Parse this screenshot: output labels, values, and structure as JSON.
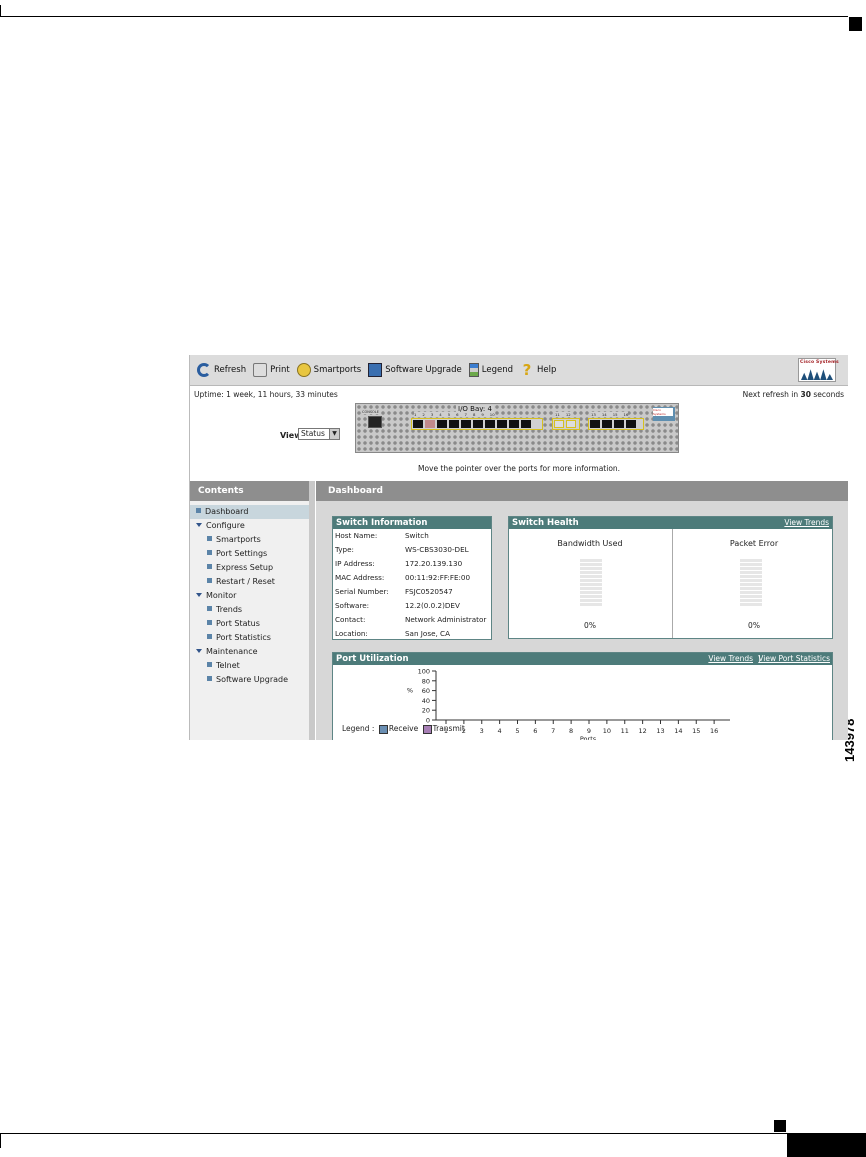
{
  "figure_number": "143978",
  "toolbar": {
    "refresh": "Refresh",
    "print": "Print",
    "smartports": "Smartports",
    "software_upgrade": "Software Upgrade",
    "legend": "Legend",
    "help": "Help",
    "logo_text": "Cisco Systems"
  },
  "status": {
    "uptime": "Uptime: 1 week, 11 hours, 33 minutes",
    "next_refresh_prefix": "Next refresh in ",
    "next_refresh_seconds": "30",
    "next_refresh_suffix": " seconds"
  },
  "view": {
    "label": "View :",
    "selected": "Status"
  },
  "switch_panel": {
    "bay_label": "I/O Bay: 4",
    "console_label": "CONSOLE",
    "port_numbers_internal": [
      "1",
      "2",
      "3",
      "4",
      "5",
      "6",
      "7",
      "8",
      "9",
      "10"
    ],
    "port_numbers_mid": [
      "11",
      "12"
    ],
    "port_numbers_external": [
      "13",
      "14",
      "15",
      "16"
    ],
    "brand_label": "Cisco Systems"
  },
  "hover_hint": "Move the pointer over the ports for more information.",
  "sidebar": {
    "title": "Contents",
    "items": [
      {
        "label": "Dashboard",
        "level": "sub-root",
        "active": true
      },
      {
        "label": "Configure",
        "level": "group"
      },
      {
        "label": "Smartports",
        "level": "sub"
      },
      {
        "label": "Port Settings",
        "level": "sub"
      },
      {
        "label": "Express Setup",
        "level": "sub"
      },
      {
        "label": "Restart / Reset",
        "level": "sub"
      },
      {
        "label": "Monitor",
        "level": "group"
      },
      {
        "label": "Trends",
        "level": "sub"
      },
      {
        "label": "Port Status",
        "level": "sub"
      },
      {
        "label": "Port Statistics",
        "level": "sub"
      },
      {
        "label": "Maintenance",
        "level": "group"
      },
      {
        "label": "Telnet",
        "level": "sub"
      },
      {
        "label": "Software Upgrade",
        "level": "sub"
      }
    ]
  },
  "main": {
    "title": "Dashboard",
    "switch_info": {
      "title": "Switch Information",
      "rows": [
        {
          "label": "Host Name:",
          "value": "Switch"
        },
        {
          "label": "Type:",
          "value": "WS-CBS3030-DEL"
        },
        {
          "label": "IP Address:",
          "value": "172.20.139.130"
        },
        {
          "label": "MAC Address:",
          "value": "00:11:92:FF:FE:00"
        },
        {
          "label": "Serial Number:",
          "value": "FSJC0520547"
        },
        {
          "label": "Software:",
          "value": "12.2(0.0.2)DEV"
        },
        {
          "label": "Contact:",
          "value": "Network Administrator"
        },
        {
          "label": "Location:",
          "value": "San Jose, CA"
        }
      ]
    },
    "switch_health": {
      "title": "Switch Health",
      "link": "View Trends",
      "bandwidth_title": "Bandwidth Used",
      "bandwidth_value": "0%",
      "packet_error_title": "Packet Error",
      "packet_error_value": "0%"
    },
    "port_utilization": {
      "title": "Port Utilization",
      "link_trends": "View Trends",
      "link_separator": "|",
      "link_statistics": "View Port Statistics",
      "legend_label": "Legend :",
      "legend_receive": "Receive",
      "legend_transmit": "Transmit"
    }
  },
  "chart_data": {
    "type": "bar",
    "categories": [
      "1",
      "2",
      "3",
      "4",
      "5",
      "6",
      "7",
      "8",
      "9",
      "10",
      "11",
      "12",
      "13",
      "14",
      "15",
      "16"
    ],
    "series": [
      {
        "name": "Receive",
        "values": [
          0,
          0,
          0,
          0,
          0,
          0,
          0,
          0,
          0,
          0,
          0,
          0,
          0,
          0,
          0,
          0
        ],
        "color": "#6a8fb3"
      },
      {
        "name": "Transmit",
        "values": [
          0,
          0,
          0,
          0,
          0,
          0,
          0,
          0,
          0,
          0,
          0,
          0,
          0,
          0,
          0,
          0
        ],
        "color": "#a77fb5"
      }
    ],
    "xlabel": "Ports",
    "ylabel": "%",
    "ylim": [
      0,
      100
    ],
    "yticks": [
      100,
      80,
      60,
      40,
      20,
      0
    ],
    "legend": "bottom-left"
  }
}
